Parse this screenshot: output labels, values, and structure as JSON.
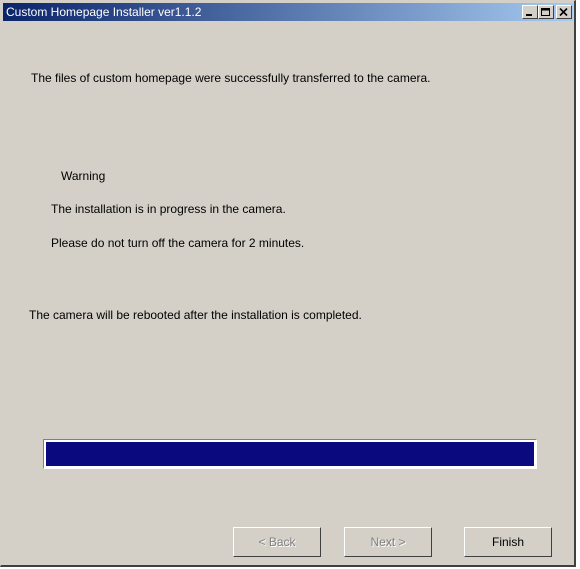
{
  "window": {
    "title": "Custom Homepage Installer ver1.1.2"
  },
  "messages": {
    "success": "The files of custom homepage were successfully transferred to the camera.",
    "warning_heading": "Warning",
    "warning_line1": "The installation is in progress in the camera.",
    "warning_line2": "Please do not turn off the camera for 2 minutes.",
    "reboot_notice": "The camera will be rebooted after the installation is completed."
  },
  "progress": {
    "fraction": 1.0
  },
  "buttons": {
    "back": "< Back",
    "next": "Next >",
    "finish": "Finish"
  },
  "colors": {
    "title_start": "#0a246a",
    "title_end": "#a6caf0",
    "progress_fill": "#0a0a7e",
    "face": "#d4d0c8"
  }
}
